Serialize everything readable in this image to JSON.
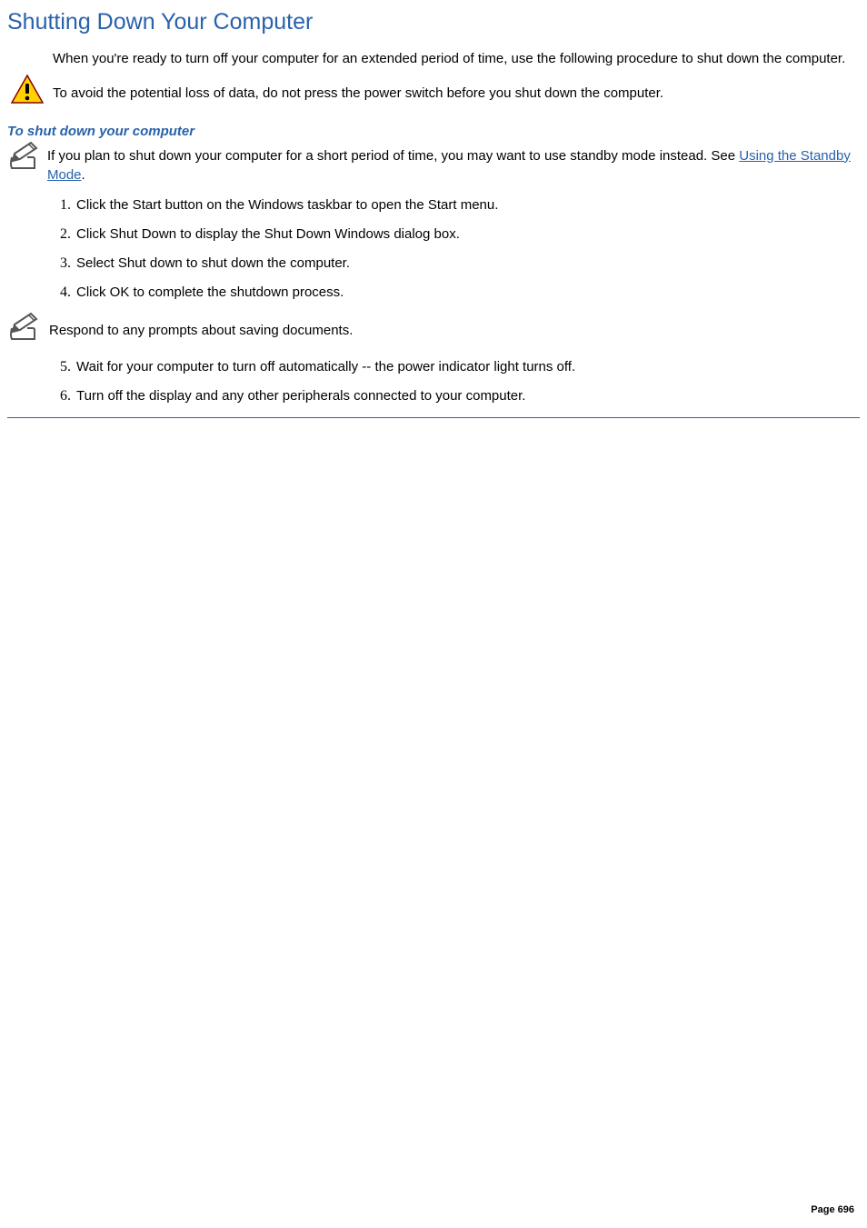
{
  "title": "Shutting Down Your Computer",
  "intro": "When you're ready to turn off your computer for an extended period of time, use the following procedure to shut down the computer.",
  "caution_text": "To avoid the potential loss of data, do not press the power switch before you shut down the computer.",
  "subhead": "To shut down your computer",
  "note1_prefix": " If you plan to shut down your computer for a short period of time, you may want to use standby mode instead. See ",
  "note1_link": "Using the Standby Mode",
  "note1_suffix": ".",
  "steps": {
    "s1": "Click the Start button on the Windows taskbar to open the Start menu.",
    "s2": "Click Shut Down to display the Shut Down Windows dialog box.",
    "s3": "Select Shut down to shut down the computer.",
    "s4": "Click OK to complete the shutdown process.",
    "s5": "Wait for your computer to turn off automatically -- the power indicator light turns off.",
    "s6": "Turn off the display and any other peripherals connected to your computer."
  },
  "note2_text": "Respond to any prompts about saving documents.",
  "footer": "Page 696"
}
